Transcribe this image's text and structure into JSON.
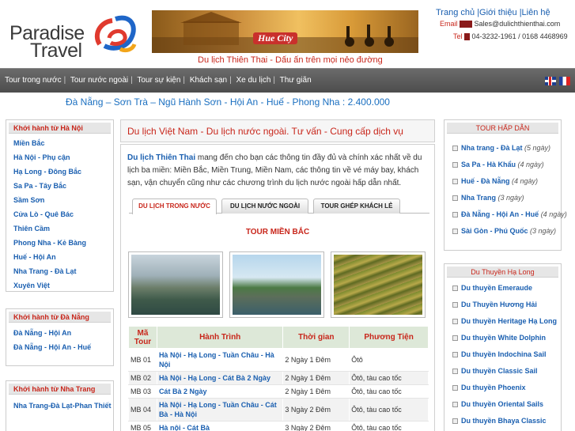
{
  "header": {
    "logo_line1": "Paradise",
    "logo_line2": "Travel",
    "banner_caption": "Hue City",
    "tagline": "Du lịch Thiên Thai - Dấu ấn trên mọi nẻo đường",
    "top_links": [
      "Trang chủ",
      "Giới thiệu",
      "Liên hệ"
    ],
    "email_label": "Email",
    "email": "Sales@dulichthienthai.com",
    "tel_label": "Tel",
    "phone": "04-3232-1961 / 0168 4468969"
  },
  "nav": {
    "items": [
      "Tour trong nước",
      "Tour nước ngoài",
      "Tour sự kiện",
      "Khách sạn",
      "Xe du lịch",
      "Thư giãn"
    ]
  },
  "promo": "Đà Nẵng – Sơn Trà – Ngũ Hành Sơn - Hội An - Huế - Phong Nha : 2.400.000",
  "left_sidebar": [
    {
      "title": "Khởi hành từ Hà Nội",
      "items": [
        "Miền Bắc",
        "Hà Nội - Phụ cận",
        "Hạ Long - Đông Bắc",
        "Sa Pa - Tây Bắc",
        "Sầm Sơn",
        "Cửa Lò - Quê Bác",
        "Thiên Cầm",
        "Phong Nha - Kẻ Bàng",
        "Huế - Hội An",
        "Nha Trang - Đà Lạt",
        "Xuyên Việt"
      ]
    },
    {
      "title": "Khởi hành từ Đà Nẵng",
      "items": [
        "Đà Nẵng - Hội An",
        "Đà Nẵng - Hội An - Huế"
      ]
    },
    {
      "title": "Khởi hành từ Nha Trang",
      "items": [
        "Nha Trang-Đà Lạt-Phan Thiết"
      ]
    }
  ],
  "center": {
    "title": "Du lịch Việt Nam - Du lịch nước ngoài. Tư vấn - Cung cấp dịch vụ",
    "intro_brand": "Du lịch Thiên Thai",
    "intro_text": " mang đến cho bạn các thông tin đầy đủ và chính xác nhất về du lịch ba miền: Miền Bắc, Miền Trung, Miền Nam, các thông tin về vé máy bay, khách sạn, vận chuyển cũng như các chương trình du lịch nước ngoài hấp dẫn nhất.",
    "tabs": [
      "DU LỊCH TRONG NƯỚC",
      "DU LỊCH NƯỚC NGOÀI",
      "TOUR GHÉP KHÁCH LẺ"
    ],
    "section_title": "TOUR MIỀN BẮC",
    "table": {
      "headers": [
        "Mã Tour",
        "Hành Trình",
        "Thời gian",
        "Phương Tiện"
      ],
      "rows": [
        [
          "MB 01",
          "Hà Nội - Hạ Long - Tuần Châu - Hà Nội",
          "2 Ngày 1 Đêm",
          "Ôtô"
        ],
        [
          "MB 02",
          "Hà Nội - Hạ Long - Cát Bà 2 Ngày",
          "2 Ngày 1 Đêm",
          "Ôtô, tàu cao tốc"
        ],
        [
          "MB 03",
          "Cát Bà 2 Ngày",
          "2 Ngày 1 Đêm",
          "Ôtô, tàu cao tốc"
        ],
        [
          "MB 04",
          "Hà Nội - Hạ Long - Tuần Châu - Cát Bà - Hà Nội",
          "3 Ngày 2 Đêm",
          "Ôtô, tàu cao tốc"
        ],
        [
          "MB 05",
          "Hà nội - Cát Bà",
          "3 Ngày 2 Đêm",
          "Ôtô, tàu cao tốc"
        ]
      ]
    }
  },
  "right_sidebar": {
    "hot_tours": {
      "title": "TOUR HẤP DẪN",
      "items": [
        {
          "name": "Nha trang - Đà Lạt",
          "days": "(5 ngày)"
        },
        {
          "name": "Sa Pa - Hà Khẩu",
          "days": "(4 ngày)"
        },
        {
          "name": "Huế - Đà Nẵng",
          "days": "(4 ngày)"
        },
        {
          "name": "Nha Trang",
          "days": "(3 ngày)"
        },
        {
          "name": "Đà Nẵng - Hội An - Huế",
          "days": "(4 ngày)"
        },
        {
          "name": "Sài Gòn - Phú Quốc",
          "days": "(3 ngày)"
        }
      ]
    },
    "cruises": {
      "title": "Du Thuyền Hạ Long",
      "items": [
        "Du thuyền Emeraude",
        "Du Thuyền Hương Hải",
        "Du thuyền Heritage Hạ Long",
        "Du thuyền White Dolphin",
        "Du thuyền Indochina Sail",
        "Du thuyền Classic Sail",
        "Du thuyền Phoenix",
        "Du thuyền Oriental Sails",
        "Du thuyền Bhaya Classic"
      ]
    }
  }
}
